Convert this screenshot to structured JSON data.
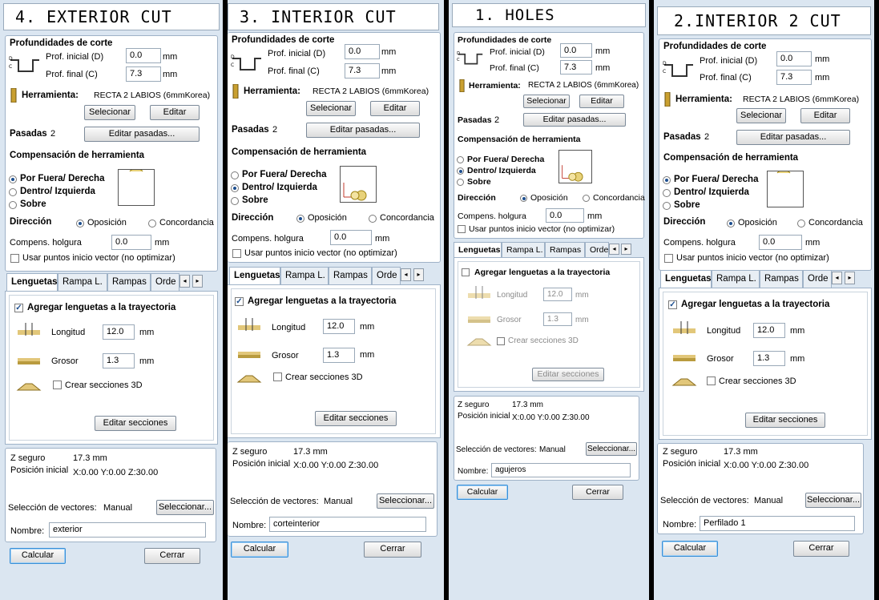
{
  "common": {
    "depth_heading": "Profundidades de corte",
    "start_depth_label": "Prof. inicial (D)",
    "end_depth_label": "Prof. final (C)",
    "unit_mm": "mm",
    "tool_label": "Herramienta:",
    "select_btn": "Selecionar",
    "edit_btn": "Editar",
    "passes_label": "Pasadas",
    "edit_passes_btn": "Editar pasadas...",
    "comp_heading": "Compensación de herramienta",
    "outside": "Por Fuera/ Derecha",
    "inside": "Dentro/ Izquierda",
    "on": "Sobre",
    "direction_label": "Dirección",
    "climb": "Oposición",
    "conventional": "Concordancia",
    "allowance_label": "Compens. holgura",
    "use_vector_start": "Usar puntos inicio vector (no optimizar)",
    "tabs": [
      "Lenguetas",
      "Rampa L.",
      "Rampas",
      "Orde"
    ],
    "add_tabs": "Agregar lenguetas a la trayectoria",
    "length_label": "Longitud",
    "thickness_label": "Grosor",
    "create_3d": "Crear secciones 3D",
    "edit_sections_btn": "Editar secciones",
    "safe_z_label": "Z seguro",
    "home_pos_label": "Posición inicial",
    "vector_sel_label": "Selección de vectores:",
    "manual": "Manual",
    "select_dots_btn": "Seleccionar...",
    "name_label": "Nombre:",
    "calc_btn": "Calcular",
    "close_btn": "Cerrar",
    "arrow_left": "◂",
    "arrow_right": "▸"
  },
  "panels": [
    {
      "title": "4. EXTERIOR CUT",
      "start_depth": "0.0",
      "end_depth": "7.3",
      "tool_name": "RECTA 2 LABIOS (6mmKorea)",
      "passes": "2",
      "allowance": "0.0",
      "tab_length": "12.0",
      "tab_thickness": "1.3",
      "safe_z": "17.3 mm",
      "home_pos": "X:0.00 Y:0.00 Z:30.00",
      "name": "exterior"
    },
    {
      "title": "3. INTERIOR CUT",
      "start_depth": "0.0",
      "end_depth": "7.3",
      "tool_name": "RECTA 2 LABIOS (6mmKorea)",
      "passes": "2",
      "allowance": "0.0",
      "tab_length": "12.0",
      "tab_thickness": "1.3",
      "safe_z": "17.3 mm",
      "home_pos": "X:0.00 Y:0.00 Z:30.00",
      "name": "corteinterior"
    },
    {
      "title": "1. HOLES",
      "start_depth": "0.0",
      "end_depth": "7.3",
      "tool_name": "RECTA 2 LABIOS (6mmKorea)",
      "passes": "2",
      "allowance": "0.0",
      "tab_length": "12.0",
      "tab_thickness": "1.3",
      "safe_z": "17.3 mm",
      "home_pos": "X:0.00 Y:0.00 Z:30.00",
      "name": "agujeros"
    },
    {
      "title": "2.INTERIOR 2 CUT",
      "start_depth": "0.0",
      "end_depth": "7.3",
      "tool_name": "RECTA 2 LABIOS (6mmKorea)",
      "passes": "2",
      "allowance": "0.0",
      "tab_length": "12.0",
      "tab_thickness": "1.3",
      "safe_z": "17.3 mm",
      "home_pos": "X:0.00 Y:0.00 Z:30.00",
      "name": "Perfilado 1"
    }
  ],
  "colors": {
    "background": "#dbe6f1",
    "panel": "#ffffff",
    "border": "#9fb2c7",
    "button_focus": "#3a8fd6"
  },
  "icons": [
    "depth-profile-icon",
    "tool-bit-icon",
    "compensation-preview-icon",
    "tab-length-icon",
    "tab-thickness-icon",
    "tab-3d-icon",
    "scroll-left-icon",
    "scroll-right-icon"
  ]
}
